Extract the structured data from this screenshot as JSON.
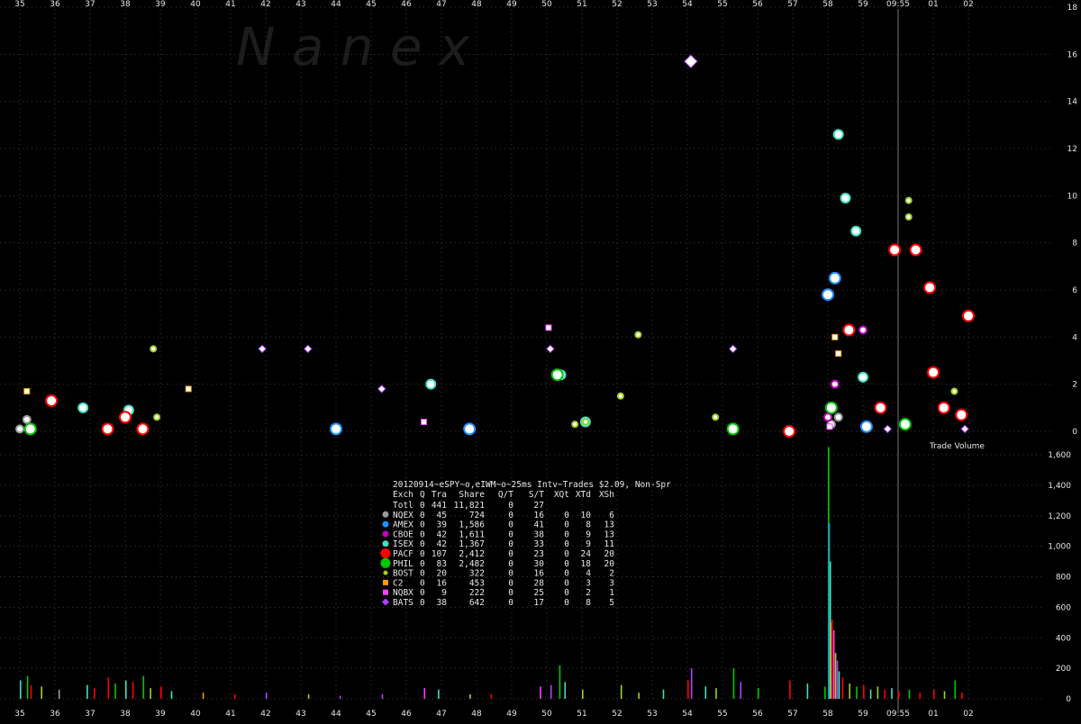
{
  "watermark": "N a n e x",
  "colors": {
    "background": "#000000",
    "grid": "#3a3a3a",
    "text": "#e6e6e6",
    "NQEX": "#9a9a9a",
    "AMEX": "#1e90ff",
    "CBOE": "#c000c0",
    "ISEX": "#40e0c0",
    "PACF": "#ff0000",
    "PHIL": "#00c800",
    "BOST": "#a0d020",
    "C2": "#ff9900",
    "NQBX": "#ff40ff",
    "BATS": "#b040ff"
  },
  "chart_data": [
    {
      "type": "scatter",
      "title": "",
      "xlabel": "",
      "ylabel": "",
      "ylim": [
        0,
        18
      ],
      "y_ticks": [
        "0",
        "2",
        "4",
        "6",
        "8",
        "10",
        "12",
        "14",
        "16",
        "18"
      ],
      "x_ticks": [
        "35",
        "36",
        "37",
        "38",
        "39",
        "40",
        "41",
        "42",
        "43",
        "44",
        "45",
        "46",
        "47",
        "48",
        "49",
        "50",
        "51",
        "52",
        "53",
        "54",
        "55",
        "56",
        "57",
        "58",
        "59",
        "09:55",
        "01",
        "02"
      ],
      "cursor_label": "09:55",
      "series": [
        {
          "name": "NQEX",
          "points": [
            [
              35.0,
              0.1
            ],
            [
              35.2,
              0.5
            ],
            [
              35.35,
              0.1
            ],
            [
              58.1,
              0.3
            ],
            [
              58.3,
              0.6
            ]
          ]
        },
        {
          "name": "AMEX",
          "points": [
            [
              58.0,
              5.8
            ],
            [
              58.2,
              6.5
            ],
            [
              59.1,
              0.2
            ],
            [
              47.8,
              0.1
            ],
            [
              44.0,
              0.1
            ]
          ]
        },
        {
          "name": "CBOE",
          "points": [
            [
              58.1,
              1.0
            ],
            [
              58.0,
              0.6
            ],
            [
              59.0,
              4.3
            ],
            [
              58.2,
              2.0
            ]
          ]
        },
        {
          "name": "ISEX",
          "points": [
            [
              36.8,
              1.0
            ],
            [
              38.1,
              0.9
            ],
            [
              46.7,
              2.0
            ],
            [
              50.4,
              2.4
            ],
            [
              51.1,
              0.4
            ],
            [
              58.3,
              12.6
            ],
            [
              58.5,
              9.9
            ],
            [
              58.8,
              8.5
            ],
            [
              59.0,
              2.3
            ]
          ]
        },
        {
          "name": "PACF",
          "points": [
            [
              35.9,
              1.3
            ],
            [
              37.5,
              0.1
            ],
            [
              38.0,
              0.6
            ],
            [
              38.5,
              0.1
            ],
            [
              56.9,
              0.0
            ],
            [
              58.6,
              4.3
            ],
            [
              59.5,
              1.0
            ],
            [
              59.9,
              7.7
            ],
            [
              60.5,
              7.7
            ],
            [
              60.9,
              6.1
            ],
            [
              61.0,
              2.5
            ],
            [
              61.3,
              1.0
            ],
            [
              61.8,
              0.7
            ],
            [
              62.0,
              4.9
            ]
          ]
        },
        {
          "name": "PHIL",
          "points": [
            [
              35.3,
              0.1
            ],
            [
              50.3,
              2.4
            ],
            [
              55.3,
              0.1
            ],
            [
              58.1,
              1.0
            ],
            [
              60.2,
              0.3
            ]
          ]
        },
        {
          "name": "BOST",
          "points": [
            [
              38.8,
              3.5
            ],
            [
              38.9,
              0.6
            ],
            [
              50.8,
              0.3
            ],
            [
              51.1,
              0.4
            ],
            [
              52.1,
              1.5
            ],
            [
              52.6,
              4.1
            ],
            [
              54.8,
              0.6
            ],
            [
              60.3,
              9.8
            ],
            [
              60.3,
              9.1
            ],
            [
              61.6,
              1.7
            ]
          ]
        },
        {
          "name": "C2",
          "points": [
            [
              35.2,
              1.7
            ],
            [
              39.8,
              1.8
            ],
            [
              58.2,
              4.0
            ],
            [
              58.3,
              3.3
            ]
          ]
        },
        {
          "name": "NQBX",
          "points": [
            [
              46.5,
              0.4
            ],
            [
              50.05,
              4.4
            ],
            [
              58.05,
              0.2
            ]
          ]
        },
        {
          "name": "BATS",
          "points": [
            [
              54.1,
              15.7
            ],
            [
              41.9,
              3.5
            ],
            [
              43.2,
              3.5
            ],
            [
              45.3,
              1.8
            ],
            [
              50.1,
              3.5
            ],
            [
              55.3,
              3.5
            ],
            [
              59.7,
              0.1
            ],
            [
              61.9,
              0.1
            ]
          ]
        }
      ]
    },
    {
      "type": "bar",
      "title": "Trade Volume",
      "ylim": [
        0,
        1600
      ],
      "y_ticks": [
        "0",
        "200",
        "400",
        "600",
        "800",
        "1,000",
        "1,200",
        "1,400",
        "1,600"
      ],
      "x_ticks": [
        "35",
        "36",
        "37",
        "38",
        "39",
        "40",
        "41",
        "42",
        "43",
        "44",
        "45",
        "46",
        "47",
        "48",
        "49",
        "50",
        "51",
        "52",
        "53",
        "54",
        "55",
        "56",
        "57",
        "58",
        "59",
        "09:55",
        "01",
        "02"
      ],
      "bars": [
        [
          35.0,
          120,
          "ISEX"
        ],
        [
          35.2,
          150,
          "PHIL"
        ],
        [
          35.3,
          90,
          "PACF"
        ],
        [
          35.6,
          80,
          "BOST"
        ],
        [
          36.1,
          60,
          "NQEX"
        ],
        [
          36.9,
          90,
          "ISEX"
        ],
        [
          37.1,
          70,
          "PACF"
        ],
        [
          37.5,
          140,
          "PACF"
        ],
        [
          37.7,
          100,
          "PHIL"
        ],
        [
          38.0,
          120,
          "ISEX"
        ],
        [
          38.2,
          110,
          "PACF"
        ],
        [
          38.5,
          150,
          "PHIL"
        ],
        [
          38.7,
          70,
          "BOST"
        ],
        [
          39.0,
          80,
          "PACF"
        ],
        [
          39.3,
          50,
          "ISEX"
        ],
        [
          40.2,
          40,
          "C2"
        ],
        [
          41.1,
          30,
          "PACF"
        ],
        [
          42.0,
          40,
          "BATS"
        ],
        [
          43.2,
          30,
          "BOST"
        ],
        [
          44.1,
          20,
          "BATS"
        ],
        [
          45.3,
          30,
          "BATS"
        ],
        [
          46.5,
          70,
          "NQBX"
        ],
        [
          46.9,
          60,
          "ISEX"
        ],
        [
          47.8,
          30,
          "BOST"
        ],
        [
          48.4,
          30,
          "PACF"
        ],
        [
          49.8,
          80,
          "NQBX"
        ],
        [
          50.1,
          90,
          "BATS"
        ],
        [
          50.35,
          220,
          "PHIL"
        ],
        [
          50.5,
          110,
          "ISEX"
        ],
        [
          51.0,
          60,
          "BOST"
        ],
        [
          52.1,
          90,
          "BOST"
        ],
        [
          52.6,
          40,
          "BOST"
        ],
        [
          53.3,
          60,
          "ISEX"
        ],
        [
          54.0,
          120,
          "PACF"
        ],
        [
          54.1,
          200,
          "BATS"
        ],
        [
          54.5,
          80,
          "ISEX"
        ],
        [
          54.8,
          70,
          "BOST"
        ],
        [
          55.3,
          200,
          "PHIL"
        ],
        [
          55.5,
          110,
          "BATS"
        ],
        [
          56.0,
          70,
          "PHIL"
        ],
        [
          56.9,
          120,
          "PACF"
        ],
        [
          57.4,
          100,
          "ISEX"
        ],
        [
          57.9,
          80,
          "PHIL"
        ],
        [
          58.0,
          1650,
          "PHIL"
        ],
        [
          58.02,
          1150,
          "AMEX"
        ],
        [
          58.05,
          900,
          "ISEX"
        ],
        [
          58.08,
          500,
          "C2"
        ],
        [
          58.1,
          520,
          "PACF"
        ],
        [
          58.15,
          450,
          "NQBX"
        ],
        [
          58.2,
          300,
          "BOST"
        ],
        [
          58.25,
          250,
          "BATS"
        ],
        [
          58.3,
          180,
          "ISEX"
        ],
        [
          58.4,
          140,
          "PACF"
        ],
        [
          58.6,
          100,
          "BOST"
        ],
        [
          58.8,
          80,
          "PHIL"
        ],
        [
          59.0,
          90,
          "PACF"
        ],
        [
          59.2,
          60,
          "ISEX"
        ],
        [
          59.4,
          80,
          "BOST"
        ],
        [
          59.6,
          60,
          "PACF"
        ],
        [
          59.8,
          70,
          "ISEX"
        ],
        [
          60.0,
          50,
          "PACF"
        ],
        [
          60.3,
          60,
          "PHIL"
        ],
        [
          60.6,
          40,
          "PACF"
        ],
        [
          61.0,
          60,
          "PACF"
        ],
        [
          61.3,
          50,
          "BOST"
        ],
        [
          61.6,
          120,
          "PHIL"
        ],
        [
          61.8,
          40,
          "PACF"
        ]
      ]
    }
  ],
  "stats_table": {
    "title": "20120914~eSPY~o,eIWM~o~25ms Intv~Trades $2.09, Non-Spr",
    "header": [
      "Exch",
      "Q",
      "Tra",
      "Share",
      "Q/T",
      "S/T",
      "XQt",
      "XTd",
      "XSh"
    ],
    "rows": [
      {
        "exch": "Totl",
        "q": "0",
        "tra": "441",
        "share": "11,821",
        "qt": "0",
        "st": "27",
        "xqt": "",
        "xtd": "",
        "xsh": "",
        "symbol": "none",
        "color": "#e6e6e6"
      },
      {
        "exch": "NQEX",
        "q": "0",
        "tra": "45",
        "share": "724",
        "qt": "0",
        "st": "16",
        "xqt": "0",
        "xtd": "10",
        "xsh": "6",
        "symbol": "circle",
        "color": "#9a9a9a"
      },
      {
        "exch": "AMEX",
        "q": "0",
        "tra": "39",
        "share": "1,586",
        "qt": "0",
        "st": "41",
        "xqt": "0",
        "xtd": "8",
        "xsh": "13",
        "symbol": "circle",
        "color": "#1e90ff"
      },
      {
        "exch": "CBOE",
        "q": "0",
        "tra": "42",
        "share": "1,611",
        "qt": "0",
        "st": "38",
        "xqt": "0",
        "xtd": "9",
        "xsh": "13",
        "symbol": "circle",
        "color": "#c000c0"
      },
      {
        "exch": "ISEX",
        "q": "0",
        "tra": "42",
        "share": "1,367",
        "qt": "0",
        "st": "33",
        "xqt": "0",
        "xtd": "9",
        "xsh": "11",
        "symbol": "circle",
        "color": "#40e0c0"
      },
      {
        "exch": "PACF",
        "q": "0",
        "tra": "107",
        "share": "2,412",
        "qt": "0",
        "st": "23",
        "xqt": "0",
        "xtd": "24",
        "xsh": "20",
        "symbol": "circle-large",
        "color": "#ff0000"
      },
      {
        "exch": "PHIL",
        "q": "0",
        "tra": "83",
        "share": "2,482",
        "qt": "0",
        "st": "30",
        "xqt": "0",
        "xtd": "18",
        "xsh": "20",
        "symbol": "circle-large",
        "color": "#00c800"
      },
      {
        "exch": "BOST",
        "q": "0",
        "tra": "20",
        "share": "322",
        "qt": "0",
        "st": "16",
        "xqt": "0",
        "xtd": "4",
        "xsh": "2",
        "symbol": "circle-small",
        "color": "#a0d020"
      },
      {
        "exch": "C2",
        "q": "0",
        "tra": "16",
        "share": "453",
        "qt": "0",
        "st": "28",
        "xqt": "0",
        "xtd": "3",
        "xsh": "3",
        "symbol": "square",
        "color": "#ff9900"
      },
      {
        "exch": "NQBX",
        "q": "0",
        "tra": "9",
        "share": "222",
        "qt": "0",
        "st": "25",
        "xqt": "0",
        "xtd": "2",
        "xsh": "1",
        "symbol": "square",
        "color": "#ff40ff"
      },
      {
        "exch": "BATS",
        "q": "0",
        "tra": "38",
        "share": "642",
        "qt": "0",
        "st": "17",
        "xqt": "0",
        "xtd": "8",
        "xsh": "5",
        "symbol": "diamond",
        "color": "#b040ff"
      }
    ]
  }
}
